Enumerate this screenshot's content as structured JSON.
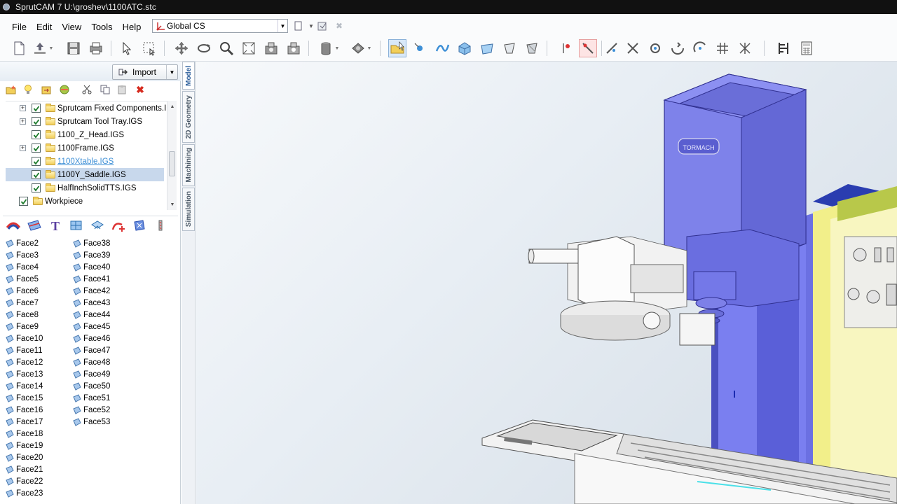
{
  "window": {
    "title": "SprutCAM 7   U:\\groshev\\1100ATC.stc"
  },
  "menu": [
    "File",
    "Edit",
    "View",
    "Tools",
    "Help"
  ],
  "coordinate_system": {
    "value": "Global CS"
  },
  "panel": {
    "import_label": "Import"
  },
  "side_tabs": [
    "Model",
    "2D Geometry",
    "Machining",
    "Simulation"
  ],
  "tree": {
    "items": [
      {
        "label": "Sprutcam Fixed Components.IGS",
        "checked": true,
        "expandable": true,
        "indent": 1
      },
      {
        "label": "Sprutcam Tool Tray.IGS",
        "checked": true,
        "expandable": true,
        "indent": 1
      },
      {
        "label": "1100_Z_Head.IGS",
        "checked": true,
        "expandable": false,
        "indent": 1
      },
      {
        "label": "1100Frame.IGS",
        "checked": true,
        "expandable": true,
        "indent": 1
      },
      {
        "label": "1100Xtable.IGS",
        "checked": true,
        "expandable": false,
        "indent": 1,
        "hover": true
      },
      {
        "label": "1100Y_Saddle.IGS",
        "checked": true,
        "expandable": false,
        "indent": 1,
        "selected": true
      },
      {
        "label": "HalfInchSolidTTS.IGS",
        "checked": true,
        "expandable": false,
        "indent": 1
      },
      {
        "label": "Workpiece",
        "checked": true,
        "expandable": false,
        "indent": 0
      }
    ]
  },
  "faces": {
    "column1": [
      "Face2",
      "Face3",
      "Face4",
      "Face5",
      "Face6",
      "Face7",
      "Face8",
      "Face9",
      "Face10",
      "Face11",
      "Face12",
      "Face13",
      "Face14",
      "Face15",
      "Face16",
      "Face17",
      "Face18",
      "Face19",
      "Face20",
      "Face21",
      "Face22",
      "Face23"
    ],
    "column2": [
      "Face38",
      "Face39",
      "Face40",
      "Face41",
      "Face42",
      "Face43",
      "Face44",
      "Face45",
      "Face46",
      "Face47",
      "Face48",
      "Face49",
      "Face50",
      "Face51",
      "Face52",
      "Face53"
    ]
  },
  "viewport": {
    "head_logo": "TORMACH"
  },
  "colors": {
    "accent": "#3d8fd6",
    "head_blue": "#7b7fe6",
    "frame_yellow": "#f4f09a",
    "selection": "#c8d8ec"
  }
}
